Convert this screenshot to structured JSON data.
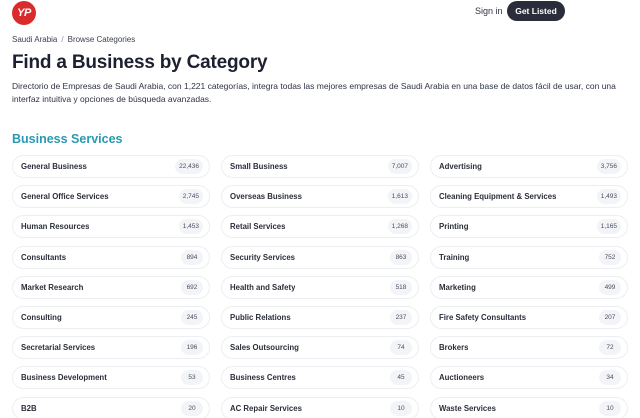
{
  "header": {
    "logo_text": "YP",
    "signin_label": "Sign in",
    "get_listed_label": "Get Listed"
  },
  "breadcrumb": {
    "items": [
      "Saudi Arabia",
      "Browse Categories"
    ],
    "separator": "/"
  },
  "page": {
    "title": "Find a Business by Category",
    "description": "Directorio de Empresas de Saudi Arabia, con 1,221 categorías, integra todas las mejores empresas de Saudi Arabia en una base de datos fácil de usar, con una interfaz intuitiva y opciones de búsqueda avanzadas."
  },
  "section": {
    "title": "Business Services",
    "categories": [
      {
        "name": "General Business",
        "count": "22,436"
      },
      {
        "name": "Small Business",
        "count": "7,007"
      },
      {
        "name": "Advertising",
        "count": "3,756"
      },
      {
        "name": "General Office Services",
        "count": "2,745"
      },
      {
        "name": "Overseas Business",
        "count": "1,613"
      },
      {
        "name": "Cleaning Equipment & Services",
        "count": "1,493"
      },
      {
        "name": "Human Resources",
        "count": "1,453"
      },
      {
        "name": "Retail Services",
        "count": "1,268"
      },
      {
        "name": "Printing",
        "count": "1,165"
      },
      {
        "name": "Consultants",
        "count": "894"
      },
      {
        "name": "Security Services",
        "count": "863"
      },
      {
        "name": "Training",
        "count": "752"
      },
      {
        "name": "Market Research",
        "count": "692"
      },
      {
        "name": "Health and Safety",
        "count": "518"
      },
      {
        "name": "Marketing",
        "count": "499"
      },
      {
        "name": "Consulting",
        "count": "245"
      },
      {
        "name": "Public Relations",
        "count": "237"
      },
      {
        "name": "Fire Safety Consultants",
        "count": "207"
      },
      {
        "name": "Secretarial Services",
        "count": "196"
      },
      {
        "name": "Sales Outsourcing",
        "count": "74"
      },
      {
        "name": "Brokers",
        "count": "72"
      },
      {
        "name": "Business Development",
        "count": "53"
      },
      {
        "name": "Business Centres",
        "count": "45"
      },
      {
        "name": "Auctioneers",
        "count": "34"
      },
      {
        "name": "B2B",
        "count": "20"
      },
      {
        "name": "AC Repair Services",
        "count": "10"
      },
      {
        "name": "Waste Services",
        "count": "10"
      }
    ]
  },
  "colors": {
    "brand_red": "#d92b2b",
    "section_teal": "#2a9ab0",
    "button_dark": "#2b2d3a"
  }
}
